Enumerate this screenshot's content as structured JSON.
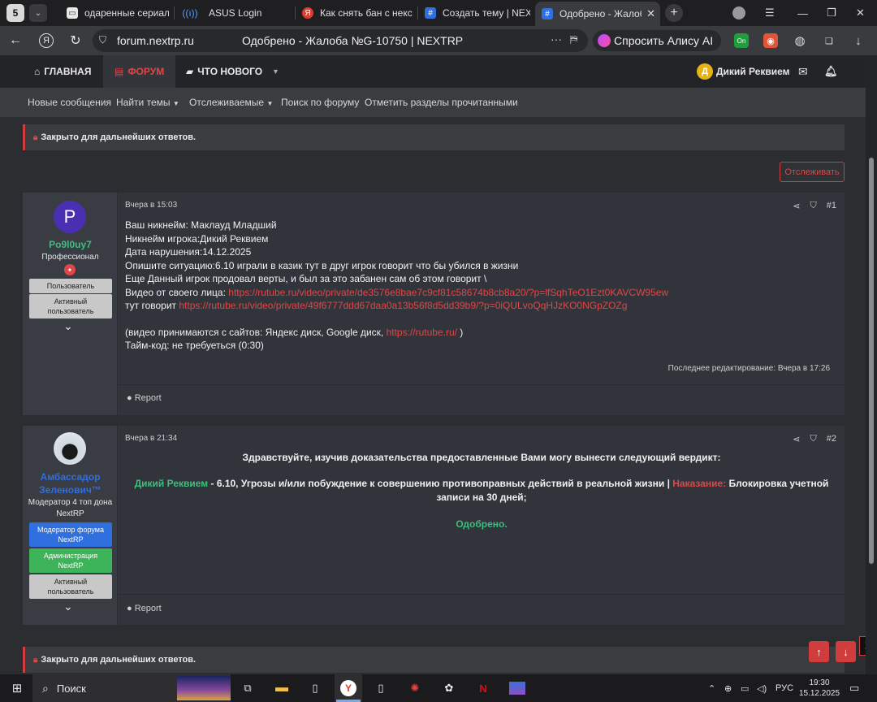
{
  "browser": {
    "tab_counter": "5",
    "tabs": [
      {
        "title": "одаренные сериал — Я",
        "active": false
      },
      {
        "title": "ASUS Login",
        "active": false
      },
      {
        "title": "Как снять бан с некст",
        "active": false
      },
      {
        "title": "Создать тему | NEXTRP",
        "active": false
      },
      {
        "title": "Одобрено - Жалоба",
        "active": true
      }
    ],
    "url_host": "forum.nextrp.ru",
    "page_title": "Одобрено - Жалоба №G-10750 | NEXTRP",
    "alisa_label": "Спросить Алису AI"
  },
  "forum": {
    "nav": {
      "home": "ГЛАВНАЯ",
      "forum": "ФОРУМ",
      "whats_new": "ЧТО НОВОГО"
    },
    "user": {
      "name": "Дикий Реквием",
      "avatar_letter": "Д"
    },
    "subnav": [
      "Новые сообщения",
      "Найти темы",
      "Отслеживаемые",
      "Поиск по форуму",
      "Отметить разделы прочитанными"
    ],
    "closed_notice": "Закрыто для дальнейших ответов.",
    "follow_button": "Отслеживать",
    "report_label": "Report"
  },
  "posts": [
    {
      "author": "Po9l0uy7",
      "avatar_letter": "P",
      "title": "Профессионал",
      "badges": [
        "Пользователь",
        "Активный пользователь"
      ],
      "time": "Вчера в 15:03",
      "number": "#1",
      "lines": [
        "Ваш никнейм: Маклауд Младший",
        "Никнейм игрока:Дикий Реквием",
        "Дата нарушения:14.12.2025",
        "Опишите ситуацию:6.10 играли в казик тут в друг игрок говорит что бы убился в жизни",
        "Еще Данный игрок продовал верты, и был за это забанен сам об этом говорит \\"
      ],
      "video_prefix": "Видео от своего лица: ",
      "video_link": "https://rutube.ru/video/private/de3576e8bae7c9cf81c58674b8cb8a20/?p=lfSqhTeO1Ezt0KAVCW95ew",
      "says_prefix": "тут говорит ",
      "says_link": "https://rutube.ru/video/private/49f6777ddd67daa0a13b56f8d5dd39b9/?p=0iQULvoQqHJzKO0NGpZOZg",
      "note_prefix": "(видео принимаются с сайтов: Яндекс диск, Google диск, ",
      "note_link": "https://rutube.ru/",
      "note_suffix": " )",
      "timecode": "Тайм-код: не требуеться (0:30)",
      "edited": "Последнее редактирование: Вчера в 17:26"
    },
    {
      "author": "Амбассадор Зеленович™",
      "title": "Модератор 4 топ дона NextRP",
      "badges": [
        "Модератор форума NextRP",
        "Администрация NextRP",
        "Активный пользователь"
      ],
      "time": "Вчера в 21:34",
      "number": "#2",
      "greeting": "Здравствуйте, изучив доказательства предоставленные Вами могу вынести следующий вердикт:",
      "verdict_name": "Дикий Реквием",
      "verdict_text": " - 6.10, Угрозы и/или побуждение к совершению противоправных действий в реальной жизни | ",
      "punishment_label": "Наказание:",
      "punishment_text": " Блокировка учетной записи на 30 дней;",
      "result": "Одобрено."
    }
  ],
  "taskbar": {
    "search_label": "Поиск",
    "lang": "РУС",
    "time": "19:30",
    "date": "15.12.2025"
  },
  "colors": {
    "accent": "#d13c3c",
    "link": "#e04646",
    "approved": "#3cbf7c"
  }
}
